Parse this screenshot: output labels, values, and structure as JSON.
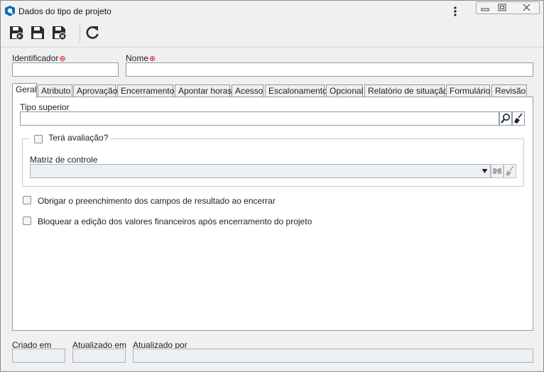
{
  "window": {
    "title": "Dados do tipo de projeto",
    "icons": [
      "app-icon",
      "more-vert-icon",
      "minimize-icon",
      "restore-icon",
      "close-icon"
    ]
  },
  "toolbar": {
    "buttons": [
      {
        "name": "save-and-new-button",
        "icon": "save-plus-icon"
      },
      {
        "name": "save-button",
        "icon": "save-icon"
      },
      {
        "name": "save-and-close-button",
        "icon": "save-close-icon"
      },
      {
        "name": "refresh-button",
        "icon": "refresh-icon"
      }
    ]
  },
  "form": {
    "identificador_label": "Identificador",
    "identificador_value": "",
    "nome_label": "Nome",
    "nome_value": "",
    "required_marker": "⊕"
  },
  "tabs": [
    {
      "label": "Geral",
      "active": true
    },
    {
      "label": "Atributo"
    },
    {
      "label": "Aprovação"
    },
    {
      "label": "Encerramento"
    },
    {
      "label": "Apontar horas"
    },
    {
      "label": "Acesso"
    },
    {
      "label": "Escalonamento"
    },
    {
      "label": "Opcional"
    },
    {
      "label": "Relatório de situação"
    },
    {
      "label": "Formulário"
    },
    {
      "label": "Revisão"
    }
  ],
  "geral": {
    "tipo_superior_label": "Tipo superior",
    "tipo_superior_value": "",
    "tera_avaliacao_label": "Terá avaliação?",
    "tera_avaliacao_checked": false,
    "matriz_label": "Matriz de controle",
    "matriz_value": "",
    "obrigar_label": "Obrigar o preenchimento dos campos de resultado ao encerrar",
    "obrigar_checked": false,
    "bloquear_label": "Bloquear a edição dos valores financeiros após encerramento do projeto",
    "bloquear_checked": false
  },
  "footer": {
    "criado_em_label": "Criado em",
    "criado_em_value": "",
    "atualizado_em_label": "Atualizado em",
    "atualizado_em_value": "",
    "atualizado_por_label": "Atualizado por",
    "atualizado_por_value": ""
  },
  "colors": {
    "accent": "#0b6db4",
    "required": "#d42020",
    "field_border": "#8b9bb0"
  }
}
